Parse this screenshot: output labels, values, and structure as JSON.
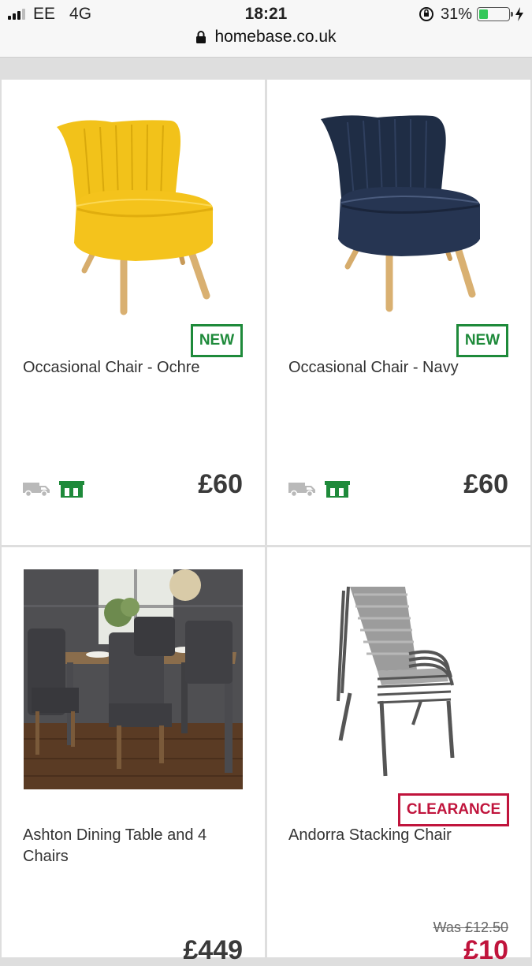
{
  "status_bar": {
    "carrier": "EE",
    "network": "4G",
    "time": "18:21",
    "battery_percent": "31%",
    "battery_level": 0.31,
    "url": "homebase.co.uk"
  },
  "products": [
    {
      "title": "Occasional Chair - Ochre",
      "badge": "NEW",
      "price": "£60",
      "image_icon": "yellow-armchair"
    },
    {
      "title": "Occasional Chair - Navy",
      "badge": "NEW",
      "price": "£60",
      "image_icon": "navy-armchair"
    },
    {
      "title": "Ashton Dining Table and 4 Chairs",
      "price": "£449",
      "image_icon": "dining-set-photo"
    },
    {
      "title": "Andorra Stacking Chair",
      "badge": "CLEARANCE",
      "was_price": "Was £12.50",
      "price": "£10",
      "image_icon": "stacked-chairs"
    }
  ],
  "colors": {
    "new_badge": "#1e8a3a",
    "clearance_badge": "#c0143c",
    "battery_fill": "#34c759"
  }
}
